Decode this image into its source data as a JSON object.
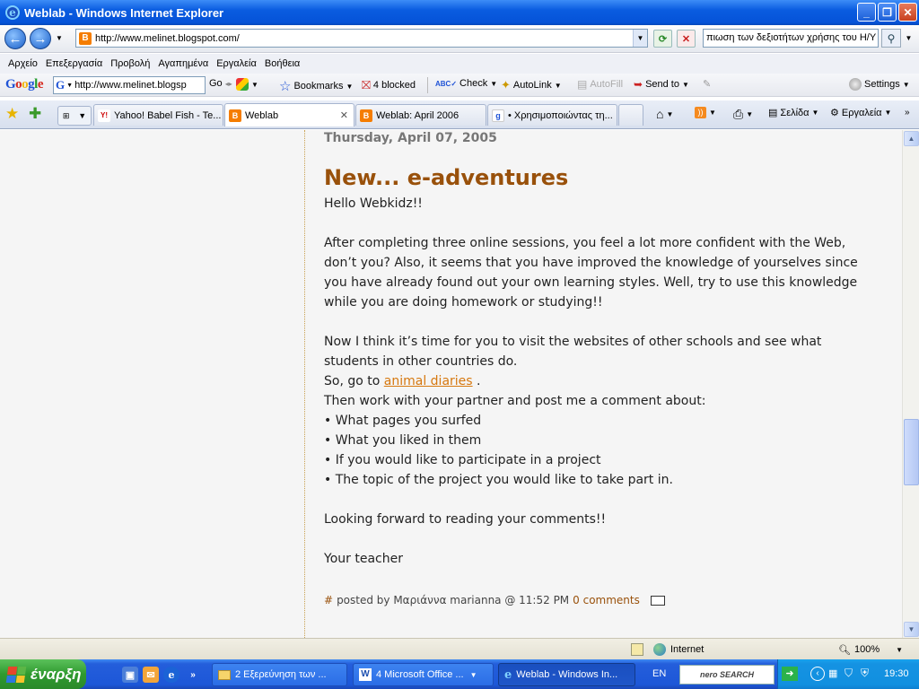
{
  "window": {
    "title": "Weblab - Windows Internet Explorer"
  },
  "address": {
    "url": "http://www.melinet.blogspot.com/"
  },
  "search": {
    "value": "πιωση των δεξιοτήτων χρήσης του Η/Υ"
  },
  "menu": [
    "Αρχείο",
    "Επεξεργασία",
    "Προβολή",
    "Αγαπημένα",
    "Εργαλεία",
    "Βοήθεια"
  ],
  "google_toolbar": {
    "url": "http://www.melinet.blogsp",
    "go": "Go",
    "bookmarks": "Bookmarks",
    "blocked": "4 blocked",
    "check": "Check",
    "autolink": "AutoLink",
    "autofill": "AutoFill",
    "sendto": "Send to",
    "settings": "Settings"
  },
  "tabs": [
    {
      "label": "Yahoo! Babel Fish - Te...",
      "icon": "Y!"
    },
    {
      "label": "Weblab",
      "icon": "B"
    },
    {
      "label": "Weblab: April 2006",
      "icon": "B"
    },
    {
      "label": "• Χρησιμοποιώντας τη...",
      "icon": "g"
    }
  ],
  "command_bar": {
    "page": "Σελίδα",
    "tools": "Εργαλεία"
  },
  "post": {
    "date": "Thursday, April 07, 2005",
    "title": "New... e-adventures",
    "greeting": "Hello Webkidz!!",
    "para1": "After completing three online sessions, you feel a lot more confident with the Web, don’t you? Also, it seems that you have improved the knowledge of yourselves since you have already found out your own learning styles. Well, try to use this knowledge while you are doing homework or studying!!",
    "para2": "Now I think it’s time for you to visit the websites of other schools and see what students in other countries do.",
    "goto_prefix": "So, go to",
    "goto_link": "animal diaries",
    "goto_suffix": " .",
    "then": "Then work with your partner and post me a comment about:",
    "bullets": [
      "• What pages you surfed",
      "• What you liked in them",
      "• If you would like to participate in a project",
      "• The topic of the project you would like to take part in."
    ],
    "closing": "Looking forward to reading your comments!!",
    "signature": "Your teacher",
    "footer_hash": "#",
    "footer_posted": "posted by Μαριάννα marianna @ 11:52 PM",
    "footer_comments": "0 comments"
  },
  "status": {
    "zone": "Internet",
    "zoom": "100%"
  },
  "taskbar": {
    "start": "έναρξη",
    "buttons": [
      "2 Εξερεύνηση των ...",
      "4 Microsoft Office ...",
      "Weblab - Windows In..."
    ],
    "lang": "EN",
    "nero": "nero SEARCH",
    "clock": "19:30"
  }
}
